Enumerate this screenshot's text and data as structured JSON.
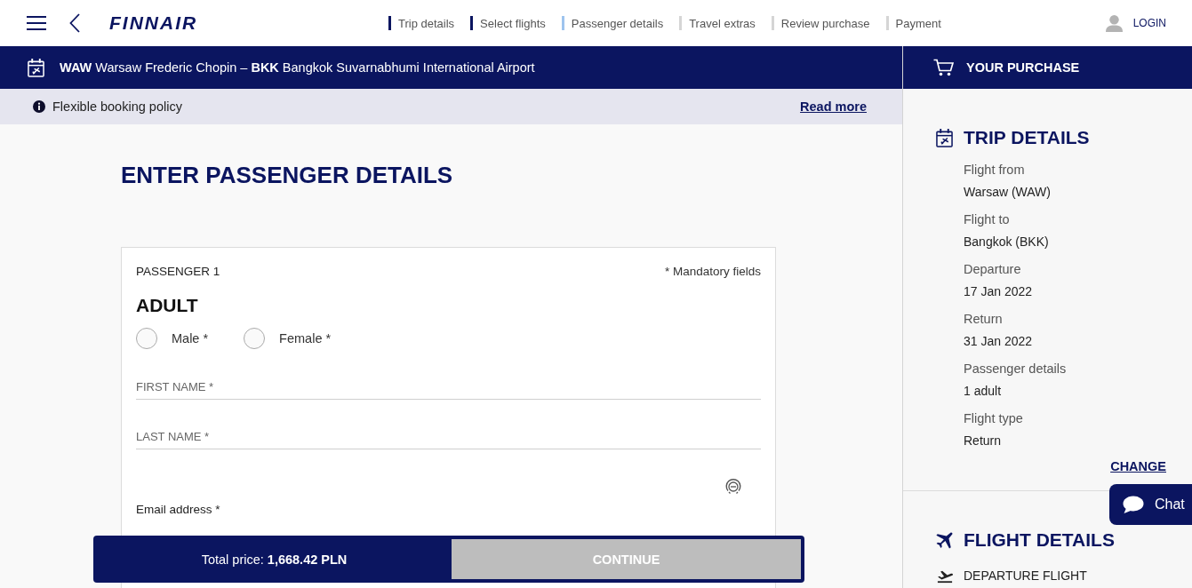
{
  "header": {
    "logo": "FINNAIR",
    "steps": [
      {
        "label": "Trip details",
        "completed": true,
        "selected": false
      },
      {
        "label": "Select flights",
        "completed": true,
        "selected": false
      },
      {
        "label": "Passenger details",
        "completed": false,
        "selected": true
      },
      {
        "label": "Travel extras",
        "completed": false,
        "selected": false
      },
      {
        "label": "Review purchase",
        "completed": false,
        "selected": false
      },
      {
        "label": "Payment",
        "completed": false,
        "selected": false
      }
    ],
    "login": "LOGIN"
  },
  "route_bar": {
    "route": "**WAW** Warsaw Frederic Chopin – **BKK** Bangkok Suvarnabhumi International Airport"
  },
  "notice": {
    "text": "Flexible booking policy",
    "link": "Read more"
  },
  "passenger_form": {
    "title": "ENTER PASSENGER DETAILS",
    "passenger_label": "PASSENGER 1",
    "mandatory_note": "* Mandatory fields",
    "passenger_type": "ADULT",
    "gender_options": [
      {
        "label": "Male *",
        "selected": false
      },
      {
        "label": "Female *",
        "selected": false
      }
    ],
    "fields": [
      {
        "kind": "text",
        "placeholder": "FIRST NAME *"
      },
      {
        "kind": "text",
        "placeholder": "LAST NAME *"
      },
      {
        "kind": "email",
        "label": "Email address *"
      }
    ]
  },
  "purchase_bar": {
    "total": "Total price: **1,668.42 PLN**",
    "continue_button": {
      "label": "CONTINUE",
      "disabled": true
    }
  },
  "sidebar": {
    "title": "YOUR PURCHASE",
    "trip_details": {
      "title": "TRIP DETAILS",
      "items": [
        {
          "label": "Flight from",
          "value": "Warsaw (WAW)"
        },
        {
          "label": "Flight to",
          "value": "Bangkok (BKK)"
        },
        {
          "label": "Departure",
          "value": "17 Jan 2022"
        },
        {
          "label": "Return",
          "value": "31 Jan 2022"
        },
        {
          "label": "Passenger details",
          "value": "1 adult"
        },
        {
          "label": "Flight type",
          "value": "Return"
        }
      ],
      "change_link": "CHANGE"
    },
    "flight_details": {
      "title": "FLIGHT DETAILS",
      "departure_label": "DEPARTURE FLIGHT"
    }
  },
  "chat_button": {
    "label": "Chat"
  }
}
